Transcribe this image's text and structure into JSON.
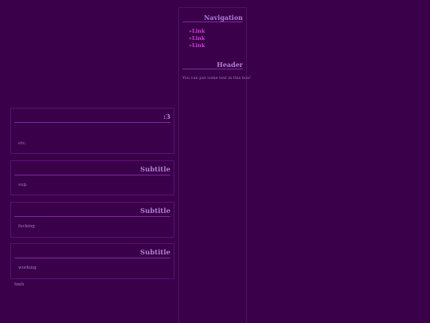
{
  "posts": [
    {
      "title": ":3",
      "body": "etc."
    },
    {
      "title": "Subtitle",
      "body": "sup."
    },
    {
      "title": "Subtitle",
      "body": "fucking"
    },
    {
      "title": "Subtitle",
      "body": "working"
    }
  ],
  "footer_text": "hmh",
  "sidebar": {
    "nav_heading": "Navigation",
    "links": [
      "»Link",
      "»Link",
      "»Link"
    ],
    "header_heading": "Header",
    "box_text": "You can put some text in this box!"
  }
}
